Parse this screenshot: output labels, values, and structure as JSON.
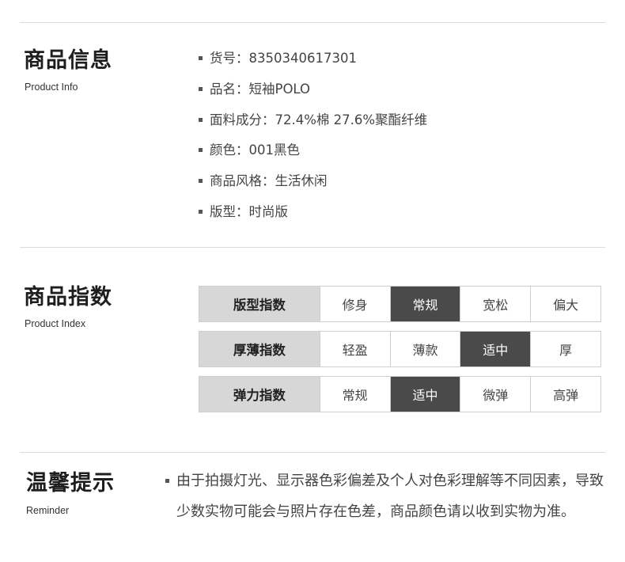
{
  "product_info": {
    "title": "商品信息",
    "subtitle": "Product Info",
    "items": [
      {
        "label": "货号",
        "value": "8350340617301"
      },
      {
        "label": "品名",
        "value": "短袖POLO"
      },
      {
        "label": "面料成分",
        "value": "72.4%棉 27.6%聚酯纤维"
      },
      {
        "label": "颜色",
        "value": "001黑色"
      },
      {
        "label": "商品风格",
        "value": "生活休闲"
      },
      {
        "label": "版型",
        "value": "时尚版"
      }
    ]
  },
  "product_index": {
    "title": "商品指数",
    "subtitle": "Product Index",
    "rows": [
      {
        "label": "版型指数",
        "options": [
          "修身",
          "常规",
          "宽松",
          "偏大"
        ],
        "selected": "常规"
      },
      {
        "label": "厚薄指数",
        "options": [
          "轻盈",
          "薄款",
          "适中",
          "厚"
        ],
        "selected": "适中"
      },
      {
        "label": "弹力指数",
        "options": [
          "常规",
          "适中",
          "微弹",
          "高弹"
        ],
        "selected": "适中"
      }
    ]
  },
  "reminder": {
    "title": "温馨提示",
    "subtitle": "Reminder",
    "text": "由于拍摄灯光、显示器色彩偏差及个人对色彩理解等不同因素，导致少数实物可能会与照片存在色差，商品颜色请以收到实物为准。"
  },
  "colors": {
    "selected_bg": "#4a4a4a",
    "label_bg": "#d7d7d7",
    "divider": "#dcdcdc"
  }
}
